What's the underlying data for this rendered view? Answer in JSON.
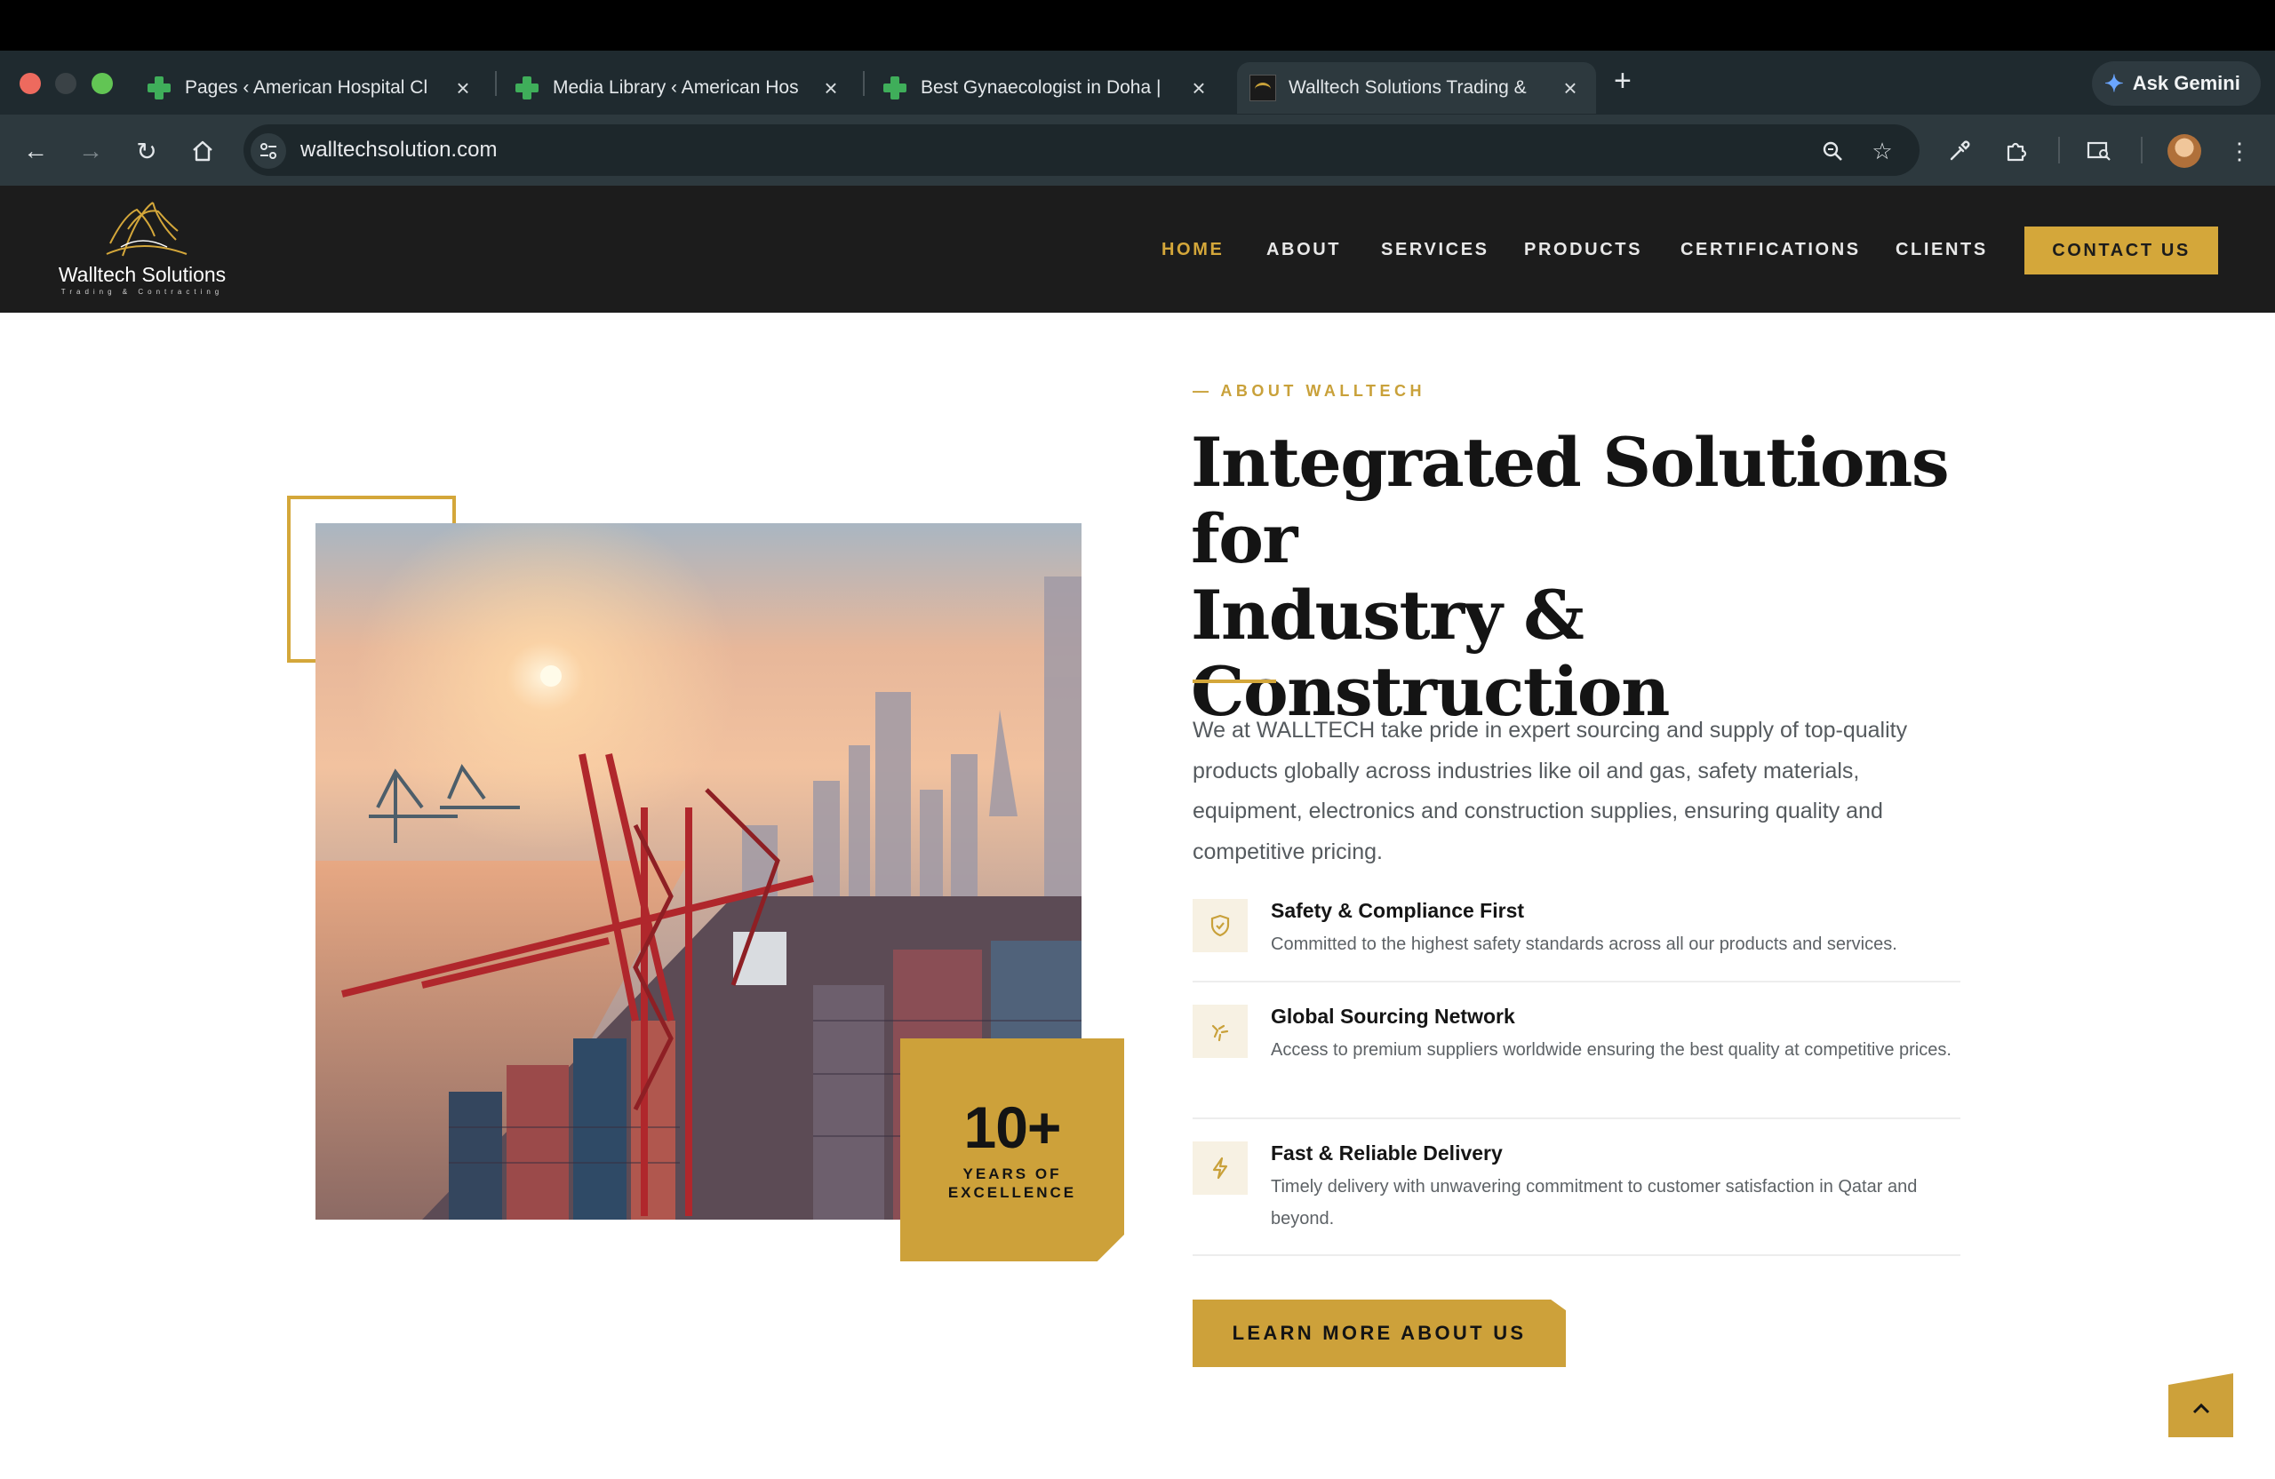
{
  "browser": {
    "tabs": [
      {
        "title": "Pages ‹ American Hospital Cl",
        "icon": "green-plus-icon"
      },
      {
        "title": "Media Library ‹ American Hos",
        "icon": "green-plus-icon"
      },
      {
        "title": "Best Gynaecologist in Doha |",
        "icon": "green-plus-icon"
      },
      {
        "title": "Walltech Solutions Trading &",
        "icon": "walltech-favicon",
        "active": true
      }
    ],
    "address": "walltechsolution.com",
    "gemini_label": "Ask Gemini"
  },
  "site": {
    "logo": {
      "name": "Walltech Solutions",
      "tagline": "Trading & Contracting"
    },
    "nav": [
      {
        "label": "HOME",
        "active": true
      },
      {
        "label": "ABOUT"
      },
      {
        "label": "SERVICES"
      },
      {
        "label": "PRODUCTS"
      },
      {
        "label": "CERTIFICATIONS"
      },
      {
        "label": "CLIENTS"
      }
    ],
    "contact_label": "CONTACT US",
    "accent_color": "#d4a73a",
    "header_color": "#1c1c1c"
  },
  "about": {
    "eyebrow": "— ABOUT WALLTECH",
    "headline_lines": [
      "Integrated Solutions for",
      "Industry &",
      "Construction"
    ],
    "intro": "We at WALLTECH take pride in expert sourcing and supply of top-quality products globally across industries like oil and gas, safety materials, equipment, electronics and construction supplies, ensuring quality and competitive pricing.",
    "badge": {
      "number": "10+",
      "line1": "YEARS OF",
      "line2": "EXCELLENCE"
    },
    "features": [
      {
        "icon": "shield-icon",
        "title": "Safety & Compliance First",
        "desc": "Committed to the highest safety standards across all our products and services."
      },
      {
        "icon": "sparkle-icon",
        "title": "Global Sourcing Network",
        "desc": "Access to premium suppliers worldwide ensuring the best quality at competitive prices."
      },
      {
        "icon": "lightning-icon",
        "title": "Fast & Reliable Delivery",
        "desc": "Timely delivery with unwavering commitment to customer satisfaction in Qatar and beyond."
      }
    ],
    "cta_label": "LEARN MORE ABOUT US",
    "image_alt": "port-cranes-skyline-image"
  }
}
